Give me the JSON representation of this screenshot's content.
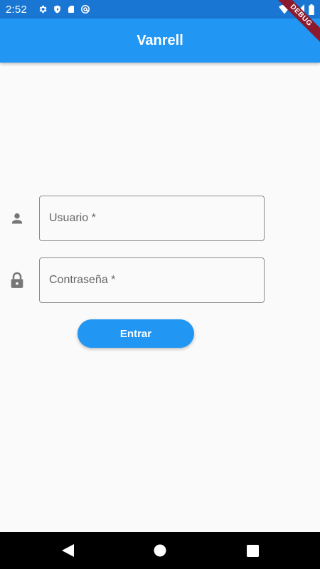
{
  "status_bar": {
    "time": "2:52",
    "icons": [
      "gear-icon",
      "shield-icon",
      "sd-card-icon",
      "at-sign-icon"
    ],
    "right_icons": [
      "wifi-icon",
      "signal-icon",
      "battery-icon"
    ]
  },
  "debug_banner": {
    "label": "DEBUG"
  },
  "app_bar": {
    "title": "Vanrell"
  },
  "form": {
    "username": {
      "placeholder": "Usuario *",
      "icon": "person-icon"
    },
    "password": {
      "placeholder": "Contraseña *",
      "icon": "lock-icon"
    },
    "submit_label": "Entrar"
  },
  "nav_bar": {
    "buttons": [
      "back-icon",
      "home-icon",
      "recents-icon"
    ]
  },
  "colors": {
    "app_bar": "#2196f3",
    "status_bar": "#1976d2",
    "button": "#2196f3",
    "debug_ribbon": "#8b1a2e",
    "background": "#fafafa"
  }
}
